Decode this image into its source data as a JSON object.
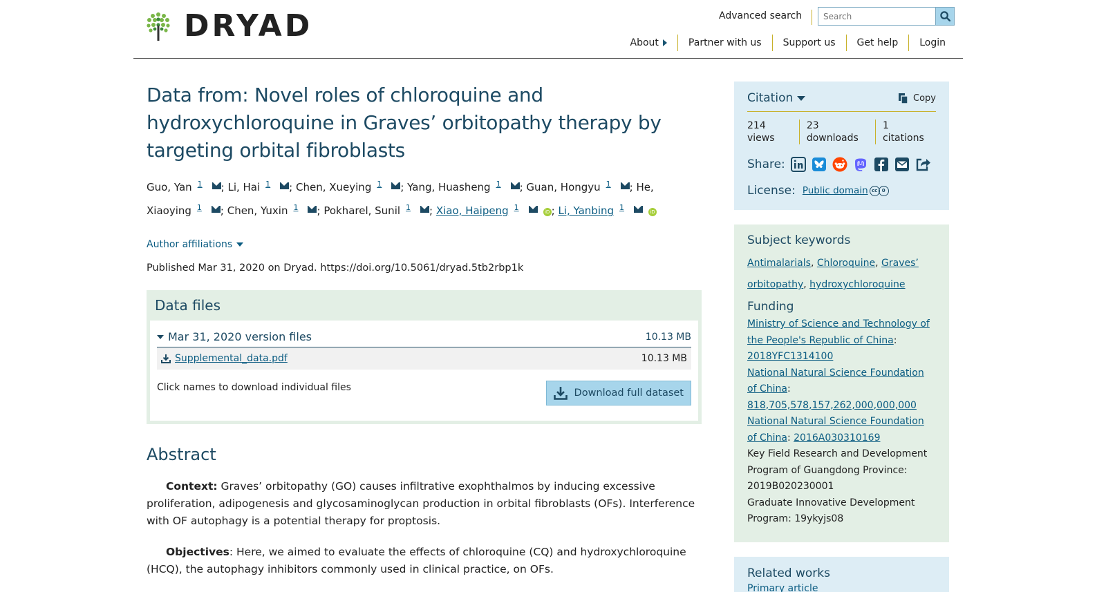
{
  "header": {
    "logo_text": "DRYAD",
    "advanced_search": "Advanced search",
    "search_placeholder": "Search",
    "nav": [
      "About",
      "Partner with us",
      "Support us",
      "Get help",
      "Login"
    ]
  },
  "dataset": {
    "title": "Data from: Novel roles of chloroquine and hydroxychloroquine in Graves’ orbitopathy therapy by targeting orbital fibroblasts",
    "authors": [
      {
        "name": "Guo, Yan",
        "sup": "1",
        "linked": false,
        "orcid": false
      },
      {
        "name": "Li, Hai",
        "sup": "1",
        "linked": false,
        "orcid": false
      },
      {
        "name": "Chen, Xueying",
        "sup": "1",
        "linked": false,
        "orcid": false
      },
      {
        "name": "Yang, Huasheng",
        "sup": "1",
        "linked": false,
        "orcid": false
      },
      {
        "name": "Guan, Hongyu",
        "sup": "1",
        "linked": false,
        "orcid": false
      },
      {
        "name": "He, Xiaoying",
        "sup": "1",
        "linked": false,
        "orcid": false
      },
      {
        "name": "Chen, Yuxin",
        "sup": "1",
        "linked": false,
        "orcid": false
      },
      {
        "name": "Pokharel, Sunil",
        "sup": "1",
        "linked": false,
        "orcid": false
      },
      {
        "name": "Xiao, Haipeng",
        "sup": "1",
        "linked": true,
        "orcid": true
      },
      {
        "name": "Li, Yanbing",
        "sup": "1",
        "linked": true,
        "orcid": true
      }
    ],
    "affiliations_toggle": "Author affiliations",
    "published": "Published Mar 31, 2020 on Dryad. https://doi.org/10.5061/dryad.5tb2rbp1k"
  },
  "data_files": {
    "heading": "Data files",
    "version_label": "Mar 31, 2020 version files",
    "version_size": "10.13 MB",
    "files": [
      {
        "name": "Supplemental_data.pdf",
        "size": "10.13 MB"
      }
    ],
    "hint": "Click names to download individual files",
    "download_label": "Download full dataset"
  },
  "abstract": {
    "heading": "Abstract",
    "paragraphs": [
      {
        "label": "Context:",
        "text": " Graves’ orbitopathy (GO) causes infiltrative exophthalmos by inducing excessive proliferation, adipogenesis and glycosaminoglycan production in orbital fibroblasts (OFs). Interference with OF autophagy is a potential therapy for proptosis."
      },
      {
        "label": "Objectives",
        "text": ": Here, we aimed to evaluate the effects of chloroquine (CQ) and hydroxychloroquine (HCQ), the autophagy inhibitors commonly used in clinical practice, on OFs."
      }
    ]
  },
  "sidebar": {
    "citation_label": "Citation",
    "copy_label": "Copy",
    "metrics": [
      "214 views",
      "23 downloads",
      "1 citations"
    ],
    "share_label": "Share:",
    "share_icons": [
      "linkedin-icon",
      "bluesky-icon",
      "reddit-icon",
      "mastodon-icon",
      "facebook-icon",
      "email-icon",
      "share-icon"
    ],
    "license_label": "License:",
    "license_value": "Public domain",
    "keywords_heading": "Subject keywords",
    "keywords": [
      "Antimalarials",
      "Chloroquine",
      "Graves’ orbitopathy",
      "hydroxychloroquine"
    ],
    "funding_heading": "Funding",
    "funding": [
      {
        "org": "Ministry of Science and Technology of the People's Republic of China",
        "org_link": true,
        "award": "2018YFC1314100",
        "award_link": true
      },
      {
        "org": "National Natural Science Foundation of China",
        "org_link": true,
        "award": "818,705,578,157,262,000,000,000",
        "award_link": true
      },
      {
        "org": "National Natural Science Foundation of China",
        "org_link": true,
        "award": "2016A030310169",
        "award_link": true
      },
      {
        "org": "Key Field Research and Development Program of Guangdong Province",
        "org_link": false,
        "award": "2019B020230001",
        "award_link": false
      },
      {
        "org": "Graduate Innovative Development Program",
        "org_link": false,
        "award": "19ykyjs08",
        "award_link": false
      }
    ],
    "related_heading": "Related works",
    "related_sub": "Primary article"
  },
  "colors": {
    "brand_blue": "#1d4a63",
    "link": "#0b5c82",
    "citation_bg": "#ddedf5",
    "keywords_bg": "#e3efe5",
    "accent_gold": "#c8b12a",
    "button_bg": "#a7d5eb"
  }
}
